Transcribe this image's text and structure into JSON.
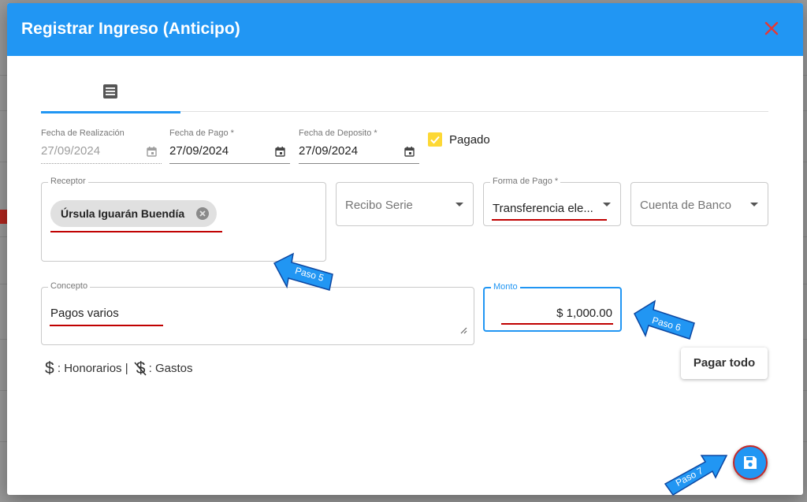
{
  "dialog": {
    "title": "Registrar Ingreso (Anticipo)",
    "close_icon": "close-icon"
  },
  "tabs": [
    {
      "icon": "list-icon",
      "active": true
    }
  ],
  "dates": {
    "realizacion": {
      "label": "Fecha de Realización",
      "value": "27/09/2024"
    },
    "pago": {
      "label": "Fecha de Pago *",
      "value": "27/09/2024"
    },
    "deposito": {
      "label": "Fecha de Deposito *",
      "value": "27/09/2024"
    }
  },
  "pagado": {
    "label": "Pagado",
    "checked": true
  },
  "receptor": {
    "label": "Receptor",
    "chip": "Úrsula Iguarán Buendía"
  },
  "recibo_serie": {
    "placeholder": "Recibo Serie"
  },
  "forma_pago": {
    "label": "Forma de Pago *",
    "value": "Transferencia ele..."
  },
  "cuenta_banco": {
    "placeholder": "Cuenta de Banco"
  },
  "concepto": {
    "label": "Concepto",
    "value": "Pagos varios"
  },
  "monto": {
    "label": "Monto",
    "value": "$ 1,000.00"
  },
  "legend": {
    "honorarios": ": Honorarios |",
    "gastos": ": Gastos"
  },
  "buttons": {
    "pagar_todo": "Pagar todo",
    "save_icon": "save-icon"
  },
  "annotations": {
    "paso5": "Paso 5",
    "paso6": "Paso 6",
    "paso7": "Paso 7"
  },
  "colors": {
    "primary": "#2196f3",
    "accent": "#fdd835",
    "annotation_line": "#c00000",
    "close": "#e53935"
  }
}
